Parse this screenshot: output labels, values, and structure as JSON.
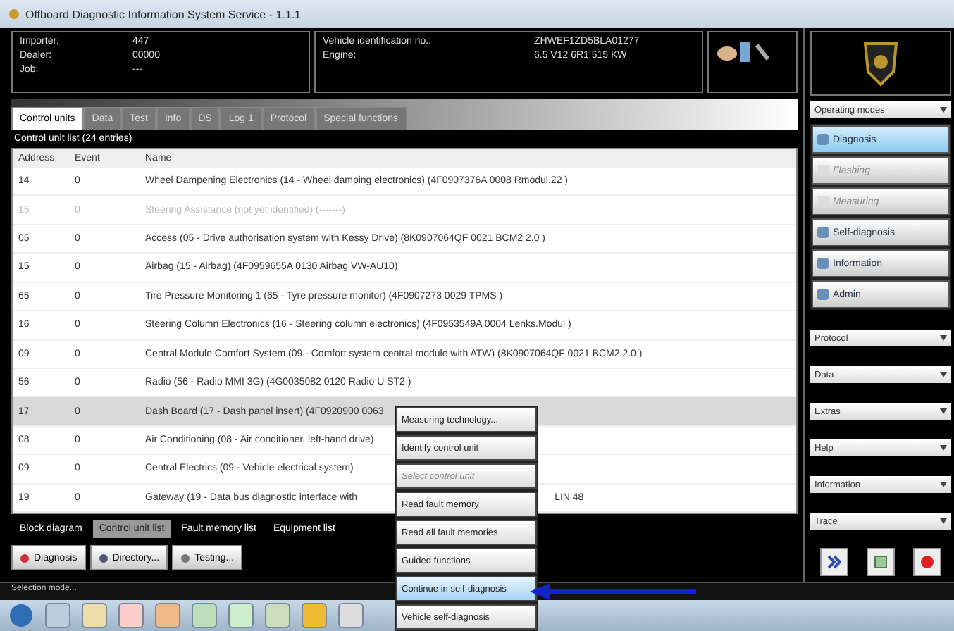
{
  "window": {
    "title": "Offboard Diagnostic Information System Service - 1.1.1"
  },
  "vehicle_info": [
    {
      "label": "Importer:",
      "value": "447"
    },
    {
      "label": "Dealer:",
      "value": "00000"
    },
    {
      "label": "Job:",
      "value": "---"
    }
  ],
  "vehicle_id": [
    {
      "label": "Vehicle identification no.:",
      "value": "ZHWEF1ZD5BLA01277"
    },
    {
      "label": "Engine:",
      "value": "6.5 V12 6R1 515 KW"
    }
  ],
  "tabs": [
    {
      "label": "Control units",
      "selected": true
    },
    {
      "label": "Data",
      "selected": false
    },
    {
      "label": "Test",
      "selected": false
    },
    {
      "label": "Info",
      "selected": false
    },
    {
      "label": "DS",
      "selected": false
    },
    {
      "label": "Log 1",
      "selected": false
    },
    {
      "label": "Protocol",
      "selected": false
    },
    {
      "label": "Special functions",
      "selected": false
    }
  ],
  "control_unit_list": {
    "title": "Control unit list (24 entries)",
    "columns": [
      "Address",
      "Event",
      "Name"
    ],
    "rows": [
      {
        "address": "14",
        "event": "0",
        "name": "Wheel Dampening Electronics (14 - Wheel damping electronics) (4F0907376A 0008 Rmodul.22 )",
        "disabled": false,
        "selected": false
      },
      {
        "address": "15",
        "event": "0",
        "name": "Steering Assistance (not yet identified) (-------)",
        "disabled": true,
        "selected": false
      },
      {
        "address": "05",
        "event": "0",
        "name": "Access (05 - Drive authorisation system with Kessy Drive) (8K0907064QF 0021 BCM2 2.0 )",
        "disabled": false,
        "selected": false
      },
      {
        "address": "15",
        "event": "0",
        "name": "Airbag (15 - Airbag) (4F0959655A 0130 Airbag VW-AU10)",
        "disabled": false,
        "selected": false
      },
      {
        "address": "65",
        "event": "0",
        "name": "Tire Pressure Monitoring 1 (65 - Tyre pressure monitor) (4F0907273 0029 TPMS )",
        "disabled": false,
        "selected": false
      },
      {
        "address": "16",
        "event": "0",
        "name": "Steering Column Electronics (16 - Steering column electronics) (4F0953549A 0004 Lenks.Modul )",
        "disabled": false,
        "selected": false
      },
      {
        "address": "09",
        "event": "0",
        "name": "Central Module Comfort System (09 - Comfort system central module with ATW) (8K0907064QF 0021 BCM2 2.0 )",
        "disabled": false,
        "selected": false
      },
      {
        "address": "56",
        "event": "0",
        "name": "Radio (56 - Radio MMI 3G) (4G0035082 0120 Radio U ST2 )",
        "disabled": false,
        "selected": false
      },
      {
        "address": "17",
        "event": "0",
        "name": "Dash Board (17 - Dash panel insert) (4F0920900 0063",
        "disabled": false,
        "selected": true
      },
      {
        "address": "08",
        "event": "0",
        "name": "Air Conditioning (08 - Air conditioner, left-hand drive)",
        "disabled": false,
        "selected": false
      },
      {
        "address": "09",
        "event": "0",
        "name": "Central Electrics (09 - Vehicle electrical system)",
        "disabled": false,
        "selected": false
      },
      {
        "address": "19",
        "event": "0",
        "name": "Gateway (19 - Data bus diagnostic interface with",
        "name_end": "LIN 48",
        "disabled": false,
        "selected": false
      }
    ]
  },
  "context_menu": [
    {
      "label": "Measuring technology...",
      "disabled": false,
      "selected": false
    },
    {
      "label": "Identify control unit",
      "disabled": false,
      "selected": false
    },
    {
      "label": "Select control unit",
      "disabled": true,
      "selected": false
    },
    {
      "label": "Read fault memory",
      "disabled": false,
      "selected": false
    },
    {
      "label": "Read all fault memories",
      "disabled": false,
      "selected": false
    },
    {
      "label": "Guided functions",
      "disabled": false,
      "selected": false
    },
    {
      "label": "Continue in self-diagnosis",
      "disabled": false,
      "selected": true
    },
    {
      "label": "Vehicle self-diagnosis",
      "disabled": false,
      "selected": false
    }
  ],
  "view_tabs": [
    {
      "label": "Block diagram",
      "selected": false
    },
    {
      "label": "Control unit list",
      "selected": true
    },
    {
      "label": "Fault memory list",
      "selected": false
    },
    {
      "label": "Equipment list",
      "selected": false
    }
  ],
  "actions": [
    "Diagnosis",
    "Directory...",
    "Testing..."
  ],
  "status_bar": "Selection mode...",
  "sidebar": {
    "operating_modes": "Operating modes",
    "modes": [
      {
        "label": "Diagnosis",
        "disabled": false,
        "selected": true
      },
      {
        "label": "Flashing",
        "disabled": true,
        "selected": false
      },
      {
        "label": "Measuring",
        "disabled": true,
        "selected": false
      },
      {
        "label": "Self-diagnosis",
        "disabled": false,
        "selected": false
      },
      {
        "label": "Information",
        "disabled": false,
        "selected": false
      },
      {
        "label": "Admin",
        "disabled": false,
        "selected": false
      }
    ],
    "menus": [
      "Protocol",
      "Data",
      "Extras",
      "Help",
      "Information",
      "Trace"
    ]
  }
}
